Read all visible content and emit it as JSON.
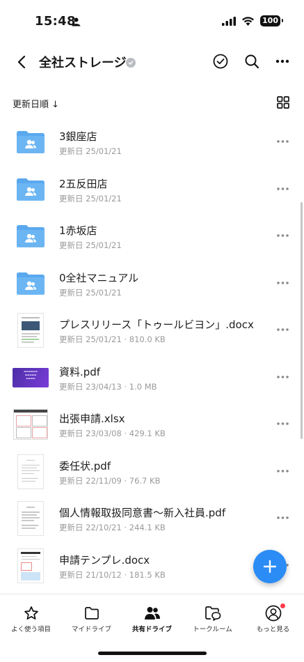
{
  "status": {
    "time": "15:48",
    "battery": "100"
  },
  "header": {
    "title": "全社ストレージ"
  },
  "sort": {
    "label": "更新日順 ↓"
  },
  "files": [
    {
      "name": "3銀座店",
      "meta": "更新日 25/01/21",
      "type": "folder"
    },
    {
      "name": "2五反田店",
      "meta": "更新日 25/01/21",
      "type": "folder"
    },
    {
      "name": "1赤坂店",
      "meta": "更新日 25/01/21",
      "type": "folder"
    },
    {
      "name": "0全社マニュアル",
      "meta": "更新日 25/01/21",
      "type": "folder"
    },
    {
      "name": "プレスリリース「トゥールビヨン」.docx",
      "meta": "更新日 25/01/21 · 810.0 KB",
      "type": "docx"
    },
    {
      "name": "資料.pdf",
      "meta": "更新日 23/04/13 · 1.0 MB",
      "type": "pdf"
    },
    {
      "name": "出張申請.xlsx",
      "meta": "更新日 23/03/08 · 429.1 KB",
      "type": "xlsx"
    },
    {
      "name": "委任状.pdf",
      "meta": "更新日 22/11/09 · 76.7 KB",
      "type": "doc"
    },
    {
      "name": "個人情報取扱同意書～新入社員.pdf",
      "meta": "更新日 22/10/21 · 244.1 KB",
      "type": "doc"
    },
    {
      "name": "申請テンプレ.docx",
      "meta": "更新日 21/10/12 · 181.5 KB",
      "type": "docx2"
    }
  ],
  "tabs": [
    {
      "label": "よく使う項目",
      "icon": "star-icon"
    },
    {
      "label": "マイドライブ",
      "icon": "folder-icon"
    },
    {
      "label": "共有ドライブ",
      "icon": "people-icon",
      "active": true
    },
    {
      "label": "トークルーム",
      "icon": "chat-folder-icon"
    },
    {
      "label": "もっと見る",
      "icon": "user-circle-icon",
      "badge": true
    }
  ],
  "colors": {
    "accent": "#2b8cf6",
    "folder": "#5aa9ef",
    "badge": "#ff3b4a"
  }
}
